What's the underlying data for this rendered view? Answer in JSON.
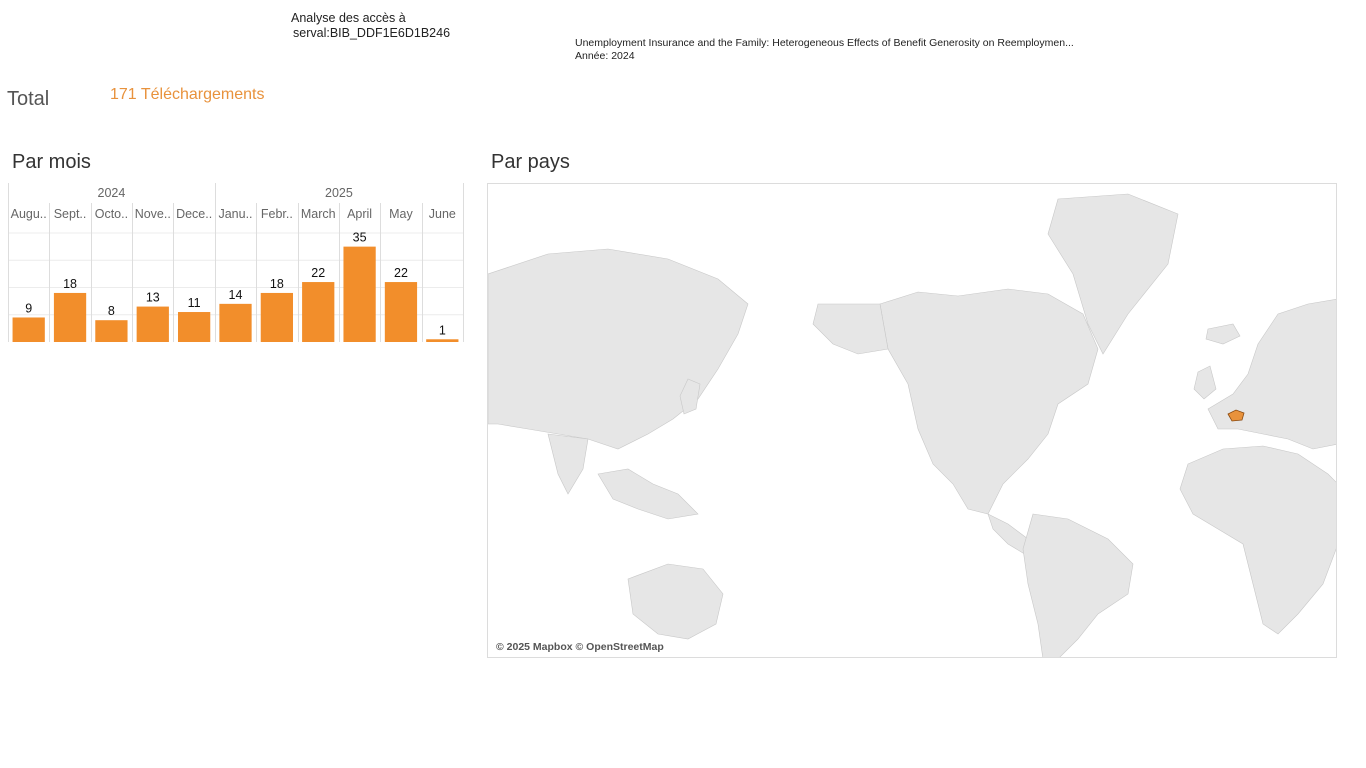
{
  "header": {
    "title_line1": "Analyse des accès à",
    "title_line2": "serval:BIB_DDF1E6D1B246",
    "publication_title": "Unemployment Insurance and the Family: Heterogeneous Effects of Benefit Generosity on Reemploymen...",
    "publication_year": "Année: 2024"
  },
  "total": {
    "label": "Total",
    "value_text": "171 Téléchargements"
  },
  "sections": {
    "by_month": "Par mois",
    "by_country": "Par pays"
  },
  "map": {
    "attribution": "© 2025 Mapbox © OpenStreetMap",
    "highlight_color": "#e8923c"
  },
  "colors": {
    "accent": "#e8923c",
    "bar": "#f28e2b"
  },
  "chart_data": {
    "type": "bar",
    "year_groups": [
      {
        "label": "2024",
        "span": 5
      },
      {
        "label": "2025",
        "span": 6
      }
    ],
    "categories": [
      "Augu..",
      "Sept..",
      "Octo..",
      "Nove..",
      "Dece..",
      "Janu..",
      "Febr..",
      "March",
      "April",
      "May",
      "June"
    ],
    "values": [
      9,
      18,
      8,
      13,
      11,
      14,
      18,
      22,
      35,
      22,
      1
    ],
    "ylim": [
      0,
      40
    ],
    "grid": true
  }
}
